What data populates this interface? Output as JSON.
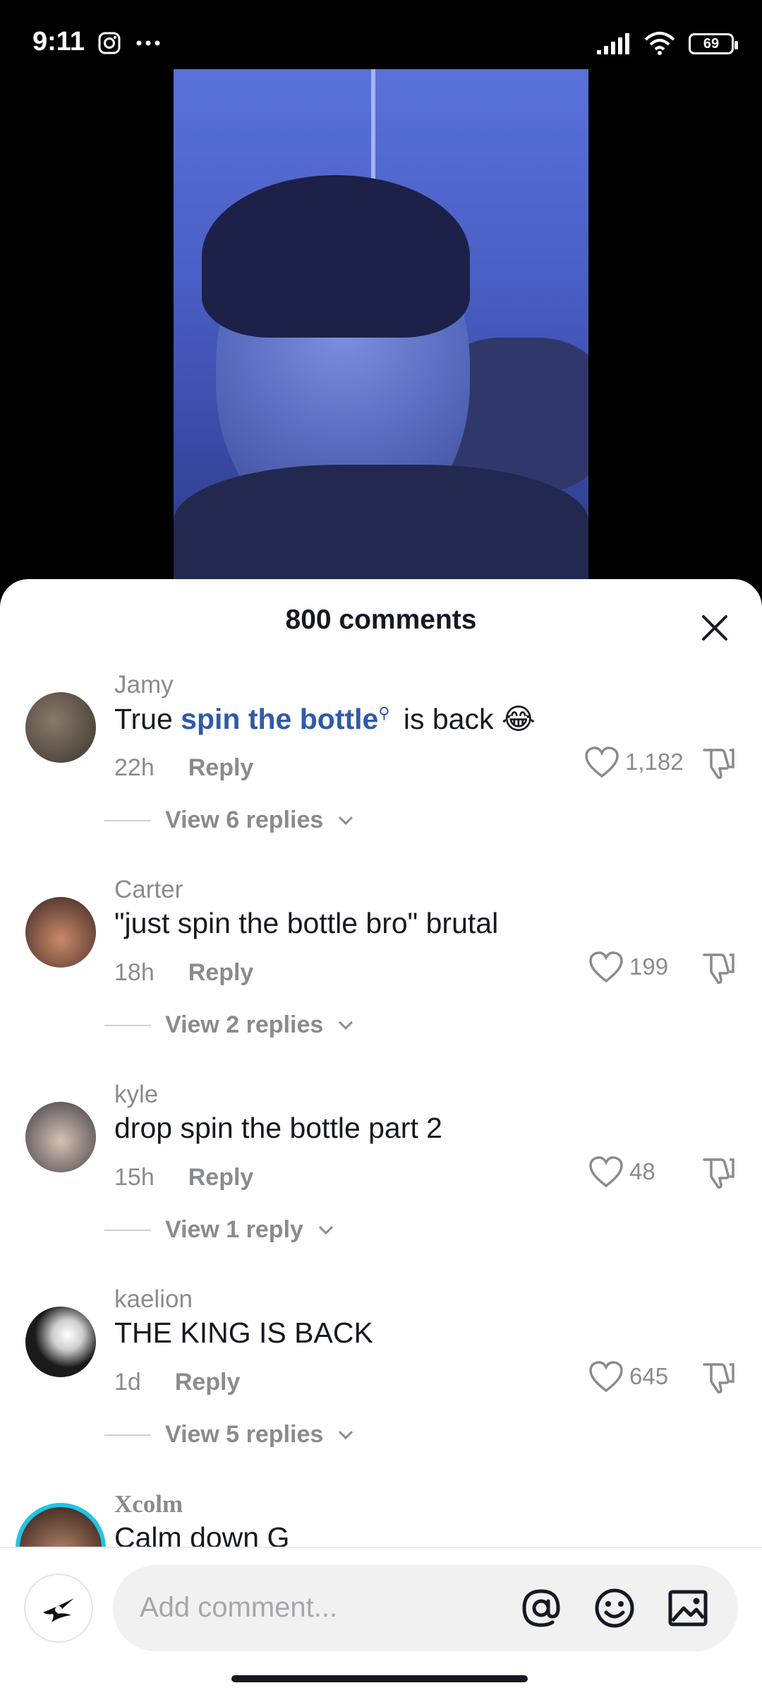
{
  "status_bar": {
    "time": "9:11",
    "battery": "69"
  },
  "sheet": {
    "title": "800 comments"
  },
  "comments": [
    {
      "username": "Jamy",
      "text_before": "True ",
      "link": "spin the bottle",
      "text_after": " is back 😂",
      "time": "22h",
      "reply": "Reply",
      "likes": "1,182",
      "view_replies": "View 6 replies"
    },
    {
      "username": "Carter",
      "text": "\"just spin the bottle bro\" brutal",
      "time": "18h",
      "reply": "Reply",
      "likes": "199",
      "view_replies": "View 2 replies"
    },
    {
      "username": "kyle",
      "text": "drop spin the bottle part 2",
      "time": "15h",
      "reply": "Reply",
      "likes": "48",
      "view_replies": "View 1 reply"
    },
    {
      "username": "kaelion",
      "text": "THE KING IS BACK",
      "time": "1d",
      "reply": "Reply",
      "likes": "645",
      "view_replies": "View 5 replies"
    },
    {
      "username": "Xcolm",
      "text": "Calm down G"
    }
  ],
  "input": {
    "placeholder": "Add comment..."
  },
  "colors": {
    "link": "#2f5aa8",
    "muted": "#8a8b91",
    "text": "#161823"
  }
}
